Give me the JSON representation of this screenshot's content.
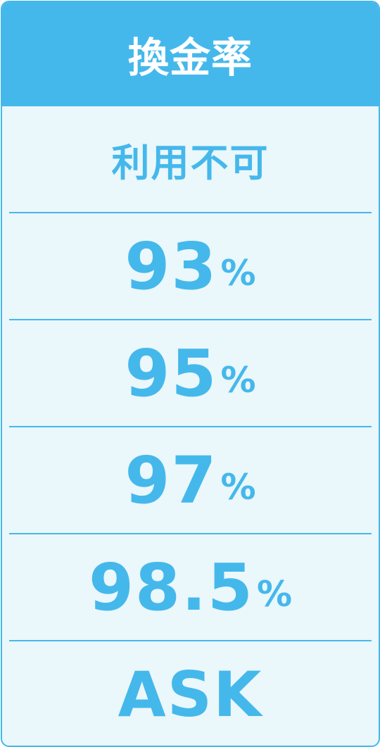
{
  "header": {
    "title": "換金率"
  },
  "rows": [
    {
      "text": "利用不可"
    },
    {
      "value": "93",
      "unit": "%"
    },
    {
      "value": "95",
      "unit": "%"
    },
    {
      "value": "97",
      "unit": "%"
    },
    {
      "value": "98.5",
      "unit": "%"
    },
    {
      "text": "ASK"
    }
  ],
  "colors": {
    "accent": "#45b8eb",
    "background": "#eaf7fb",
    "header_text": "#ffffff"
  }
}
